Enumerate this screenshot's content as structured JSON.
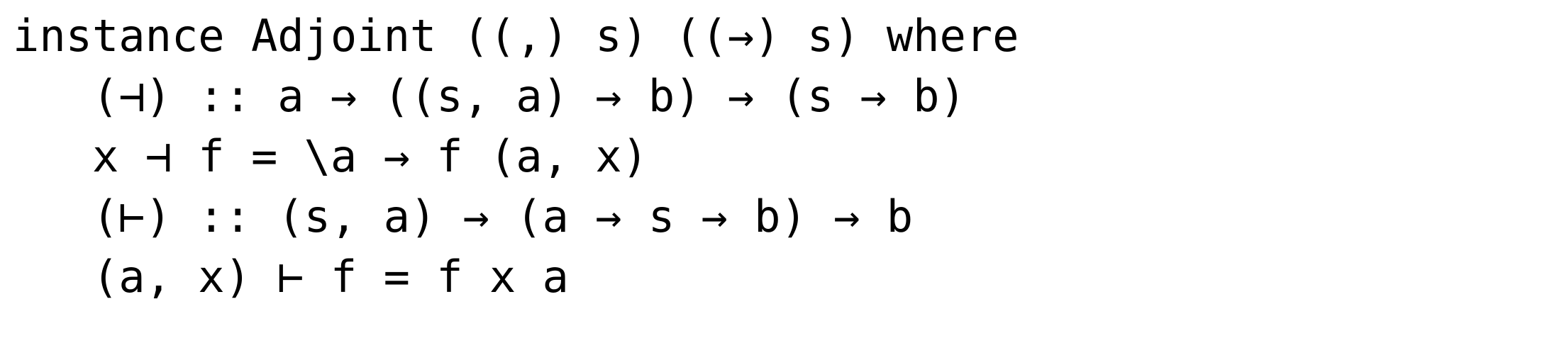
{
  "document": {
    "kind": "code-snippet",
    "language": "Haskell",
    "background_color": "#ffffff",
    "text_color": "#000000",
    "font_style": "monospace",
    "line_count": 5
  },
  "code": {
    "lines": [
      "instance Adjoint ((,) s) ((→) s) where",
      "   (⊣) :: a → ((s, a) → b) → (s → b)",
      "   x ⊣ f = \\a → f (a, x)",
      "   (⊢) :: (s, a) → (a → s → b) → b",
      "   (a, x) ⊢ f = f x a"
    ]
  }
}
